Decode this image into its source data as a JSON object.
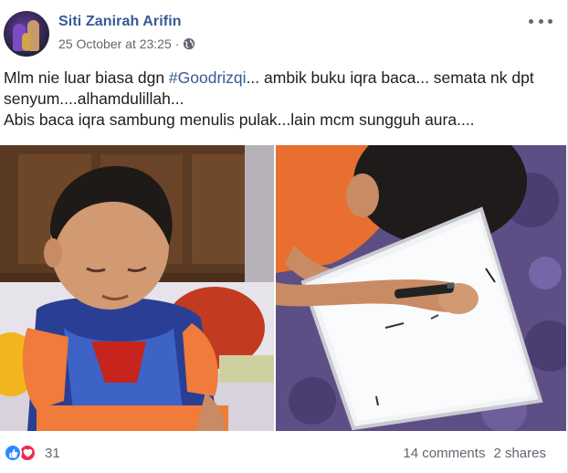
{
  "post": {
    "author": "Siti Zanirah Arifin",
    "timestamp": "25 October at 23:25",
    "separator": "·",
    "text_line1_before": "Mlm nie luar biasa dgn ",
    "hashtag": "#Goodrizqi",
    "text_line1_after": "... ambik buku iqra baca... semata nk dpt senyum....alhamdulillah...",
    "text_line2": "Abis baca iqra sambung menulis pulak...lain mcm sungguh aura....",
    "privacy_icon": "globe-icon",
    "menu_icon": "more-options-icon"
  },
  "photos": [
    {
      "name": "photo-child-reading",
      "description_icon": "photo"
    },
    {
      "name": "photo-child-writing-whiteboard",
      "description_icon": "photo"
    }
  ],
  "footer": {
    "reaction_icons": [
      "like-icon",
      "love-icon"
    ],
    "reaction_count": "31",
    "comments": "14 comments",
    "shares": "2 shares"
  },
  "colors": {
    "link_blue": "#385898",
    "secondary_text": "#606770",
    "like_blue": "#2d88ff",
    "love_red": "#f0284a"
  }
}
